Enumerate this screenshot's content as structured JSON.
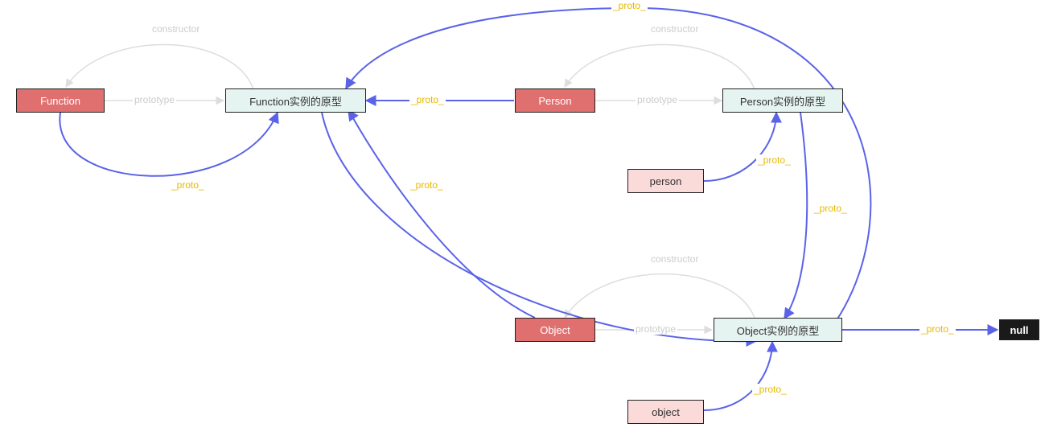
{
  "diagram": {
    "nodes": {
      "function": {
        "label": "Function",
        "kind": "constructor-builtin"
      },
      "function_proto": {
        "label": "Function实例的原型",
        "kind": "prototype-object"
      },
      "person": {
        "label": "Person",
        "kind": "constructor-user"
      },
      "person_proto": {
        "label": "Person实例的原型",
        "kind": "prototype-object"
      },
      "person_instance": {
        "label": "person",
        "kind": "instance"
      },
      "object": {
        "label": "Object",
        "kind": "constructor-builtin"
      },
      "object_proto": {
        "label": "Object实例的原型",
        "kind": "prototype-object"
      },
      "object_instance": {
        "label": "object",
        "kind": "instance"
      },
      "null": {
        "label": "null",
        "kind": "null"
      }
    },
    "edge_labels": {
      "proto": "_proto_",
      "prototype": "prototype",
      "constructor": "constructor"
    },
    "edges": [
      {
        "from": "function",
        "to": "function_proto",
        "kind": "prototype"
      },
      {
        "from": "function_proto",
        "to": "function",
        "kind": "constructor"
      },
      {
        "from": "function",
        "to": "function_proto",
        "kind": "_proto_"
      },
      {
        "from": "person",
        "to": "function_proto",
        "kind": "_proto_"
      },
      {
        "from": "person",
        "to": "person_proto",
        "kind": "prototype"
      },
      {
        "from": "person_proto",
        "to": "person",
        "kind": "constructor"
      },
      {
        "from": "person_instance",
        "to": "person_proto",
        "kind": "_proto_"
      },
      {
        "from": "person_proto",
        "to": "object_proto",
        "kind": "_proto_"
      },
      {
        "from": "object",
        "to": "object_proto",
        "kind": "prototype"
      },
      {
        "from": "object_proto",
        "to": "object",
        "kind": "constructor"
      },
      {
        "from": "object",
        "to": "function_proto",
        "kind": "_proto_"
      },
      {
        "from": "object_instance",
        "to": "object_proto",
        "kind": "_proto_"
      },
      {
        "from": "object_proto",
        "to": "null",
        "kind": "_proto_"
      },
      {
        "from": "function_proto",
        "to": "object_proto",
        "kind": "_proto_"
      }
    ],
    "colors": {
      "proto_edge": "#5a63e8",
      "light_edge": "#dddddd",
      "proto_label": "#e6b800",
      "light_label": "#cccccc",
      "node_red": "#e07070",
      "node_pink": "#fbdada",
      "node_teal": "#e6f4f1",
      "node_black": "#1a1a1a"
    }
  }
}
